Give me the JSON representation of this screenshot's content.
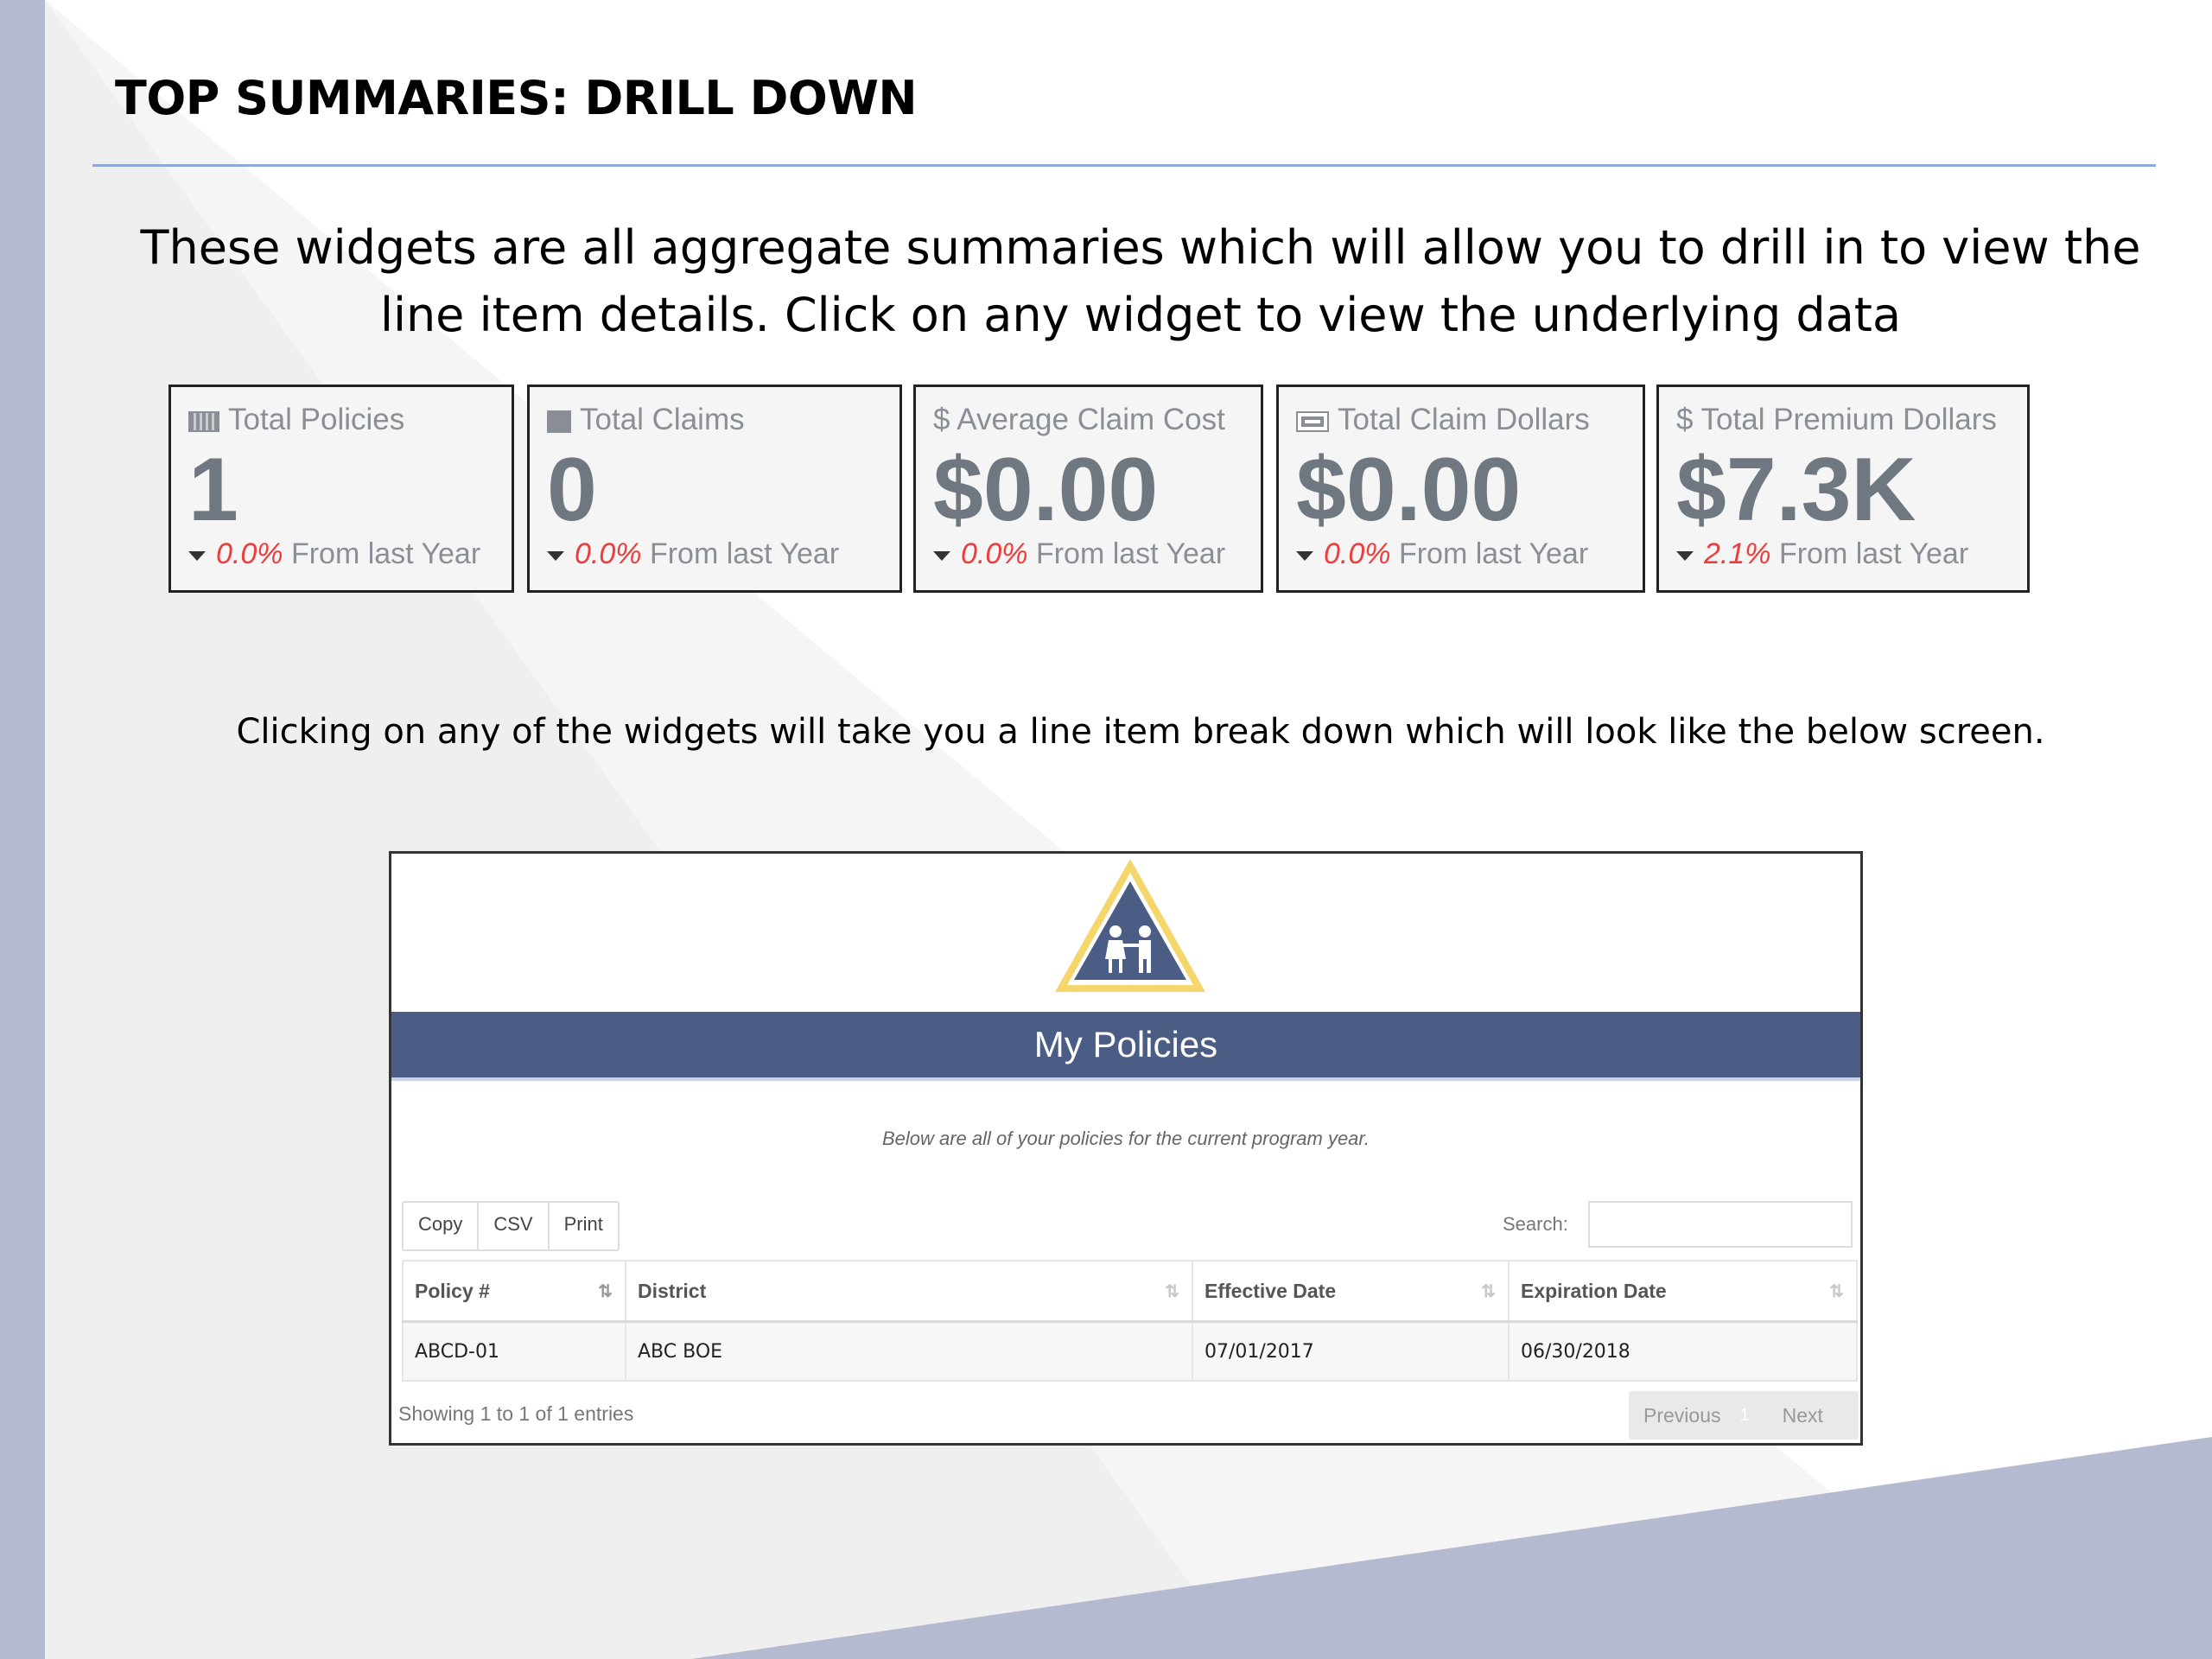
{
  "slide": {
    "title": "TOP SUMMARIES: DRILL DOWN",
    "intro": "These widgets are all aggregate summaries which will allow you to drill in to view the line item details. Click on any widget to view the underlying data",
    "caption": "Clicking on any of the widgets will take you a line item break down which will look like the below screen."
  },
  "widgets": [
    {
      "label": "Total Policies",
      "icon": "table-icon",
      "value": "1",
      "change": "0.0%",
      "change_text": "From last Year"
    },
    {
      "label": "Total Claims",
      "icon": "folder-icon",
      "value": "0",
      "change": "0.0%",
      "change_text": "From last Year"
    },
    {
      "label": "$ Average Claim Cost",
      "icon": "dollar-icon",
      "value": "$0.00",
      "change": "0.0%",
      "change_text": "From last Year"
    },
    {
      "label": "Total Claim Dollars",
      "icon": "money-icon",
      "value": "$0.00",
      "change": "0.0%",
      "change_text": "From last Year"
    },
    {
      "label": "$ Total Premium Dollars",
      "icon": "dollar-icon",
      "value": "$7.3K",
      "change": "2.1%",
      "change_text": "From last Year"
    }
  ],
  "policies": {
    "logo": "children-triangle-logo",
    "title": "My Policies",
    "subtitle": "Below are all of your policies for the current program year.",
    "buttons": [
      "Copy",
      "CSV",
      "Print"
    ],
    "search_label": "Search:",
    "search_value": "",
    "columns": [
      "Policy #",
      "District",
      "Effective Date",
      "Expiration Date"
    ],
    "rows": [
      [
        "ABCD-01",
        "ABC BOE",
        "07/01/2017",
        "06/30/2018"
      ]
    ],
    "entries": "Showing 1 to 1 of 1 entries",
    "pager": {
      "previous": "Previous",
      "page": "1",
      "next": "Next"
    }
  },
  "colors": {
    "banner": "#4b5d85",
    "accent_rule": "#8ea9d8",
    "change_negative": "#ee3b3b",
    "background_shape": "#b4bbd0",
    "logo_yellow": "#f5d66b"
  }
}
